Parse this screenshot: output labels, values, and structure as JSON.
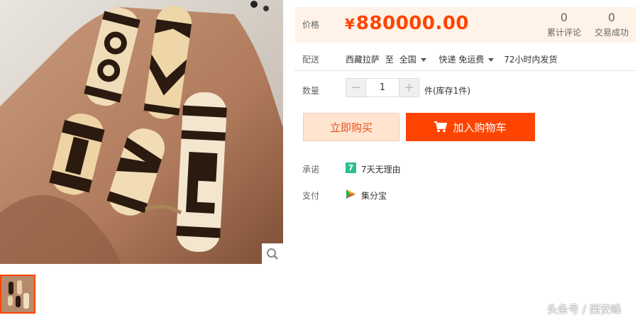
{
  "product": {
    "price_label": "价格",
    "currency": "¥",
    "price": "880000.00",
    "reviews_count": "0",
    "reviews_label": "累计评论",
    "sales_count": "0",
    "sales_label": "交易成功"
  },
  "shipping": {
    "label": "配送",
    "origin": "西藏拉萨",
    "to": "至",
    "destination": "全国",
    "method": "快递 免运费",
    "dispatch": "72小时内发货"
  },
  "quantity": {
    "label": "数量",
    "minus": "−",
    "value": "1",
    "plus": "+",
    "stock": "件(库存1件)"
  },
  "actions": {
    "buy_now": "立即购买",
    "add_to_cart": "加入购物车"
  },
  "promise": {
    "label": "承诺",
    "badge": "7",
    "text": "7天无理由"
  },
  "payment": {
    "label": "支付",
    "text": "集分宝"
  },
  "watermark": "头条号 / 西安峰",
  "colors": {
    "accent": "#ff4400",
    "price_bg": "#fff2e8",
    "buy_now_bg": "#ffe4d0",
    "promise_green": "#2dbe8a"
  }
}
